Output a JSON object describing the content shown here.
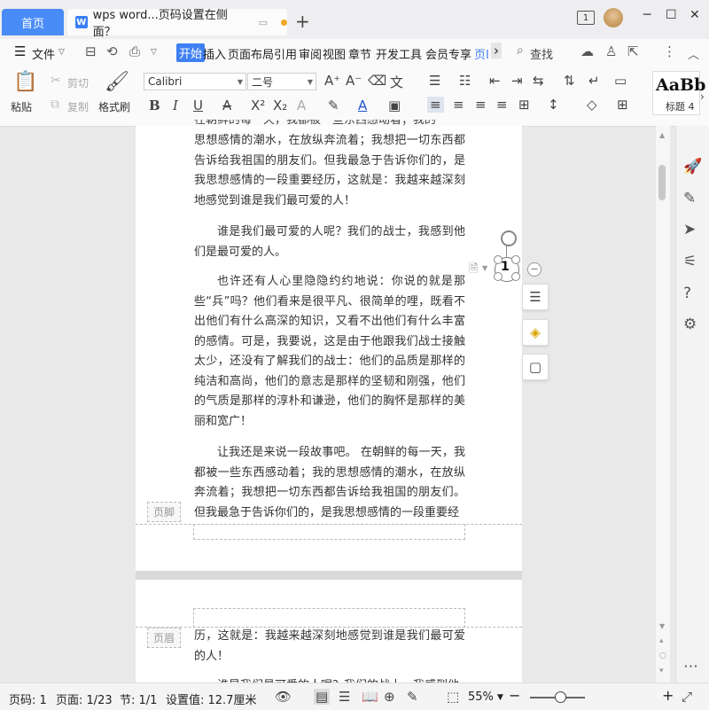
{
  "tabs": {
    "home": "首页",
    "document": "wps word...页码设置在侧面？",
    "new_tab": "+"
  },
  "window": {
    "page_num_icon": "1",
    "min": "─",
    "max": "☐",
    "close": "✕"
  },
  "menu": {
    "hamburger": "☰",
    "file": "文件",
    "items": [
      "开始",
      "插入",
      "页面布局",
      "引用",
      "审阅",
      "视图",
      "章节",
      "开发工具",
      "会员专享"
    ],
    "truncated": "页Ⅰ",
    "more": "›",
    "search": "查找"
  },
  "toolbar": {
    "paste": "粘贴",
    "cut": "剪切",
    "copy": "复制",
    "format_painter": "格式刷",
    "font_name": "Calibri",
    "font_size": "二号",
    "style_sample": "AaBb",
    "style_name": "标题 4"
  },
  "page1": {
    "para_top": "思想感情的潮水，在放纵奔流着；我想把一切东西都告诉给我祖国的朋友们。但我最急于告诉你们的，是我思想感情的一段重要经历，这就是：我越来越深刻地感觉到谁是我们最可爱的人！",
    "para_2": "谁是我们最可爱的人呢？我们的战士，我感到他们是最可爱的人。",
    "para_3": "也许还有人心里隐隐约约地说：你说的就是那些“兵”吗？他们看来是很平凡、很简单的哩，既看不出他们有什么高深的知识，又看不出他们有什么丰富的感情。可是，我要说，这是由于他跟我们战士接触太少，还没有了解我们的战士：他们的品质是那样的纯洁和高尚，他们的意志是那样的坚韧和刚强，他们的气质是那样的淳朴和谦逊，他们的胸怀是那样的美丽和宽广！",
    "para_4": "让我还是来说一段故事吧。    在朝鲜的每一天，我都被一些东西感动着；我的思想感情的潮水，在放纵奔流着；我想把一切东西都告诉给我祖国的朋友们。但我最急于告诉你们的，是我思想感情的一段重要经",
    "footer_label": "页脚",
    "page_number": "1"
  },
  "page2": {
    "header_label": "页眉",
    "para_1": "历，这就是：我越来越深刻地感觉到谁是我们最可爱的人！",
    "para_2_partial": "谁是我们最可爱的人呢？我们的战士，我感到他"
  },
  "status": {
    "page_code": "页码: 1",
    "page": "页面: 1/23",
    "section": "节: 1/1",
    "setting": "设置值: 12.7厘米",
    "zoom": "55%",
    "zoom_minus": "−",
    "zoom_plus": "+"
  },
  "colors": {
    "accent": "#3f7ff4",
    "tab_home": "#4a8cf7",
    "doc_dot": "#f5a623"
  }
}
